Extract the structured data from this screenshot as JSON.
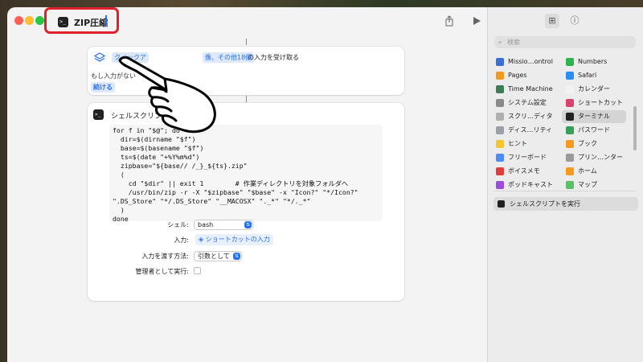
{
  "window": {
    "title": "ZIP圧縮"
  },
  "action_card_input": {
    "pill_quick": "クイックア",
    "pill_image": "像、その他18個",
    "receive_text": "の入力を受け取る",
    "no_input_text": "もし入力がない",
    "continue_label": "続ける"
  },
  "action_card_script": {
    "title": "シェルスクリプトを実行",
    "code": "for f in \"$@\"; do\n  dir=$(dirname \"$f\")\n  base=$(basename \"$f\")\n  ts=$(date \"+%Y%m%d\")\n  zipbase=\"${base// /_}_${ts}.zip\"\n  (\n    cd \"$dir\" || exit 1        # 作業ディレクトリを対象フォルダへ\n    /usr/bin/zip -r -X \"$zipbase\" \"$base\" -x \"Icon?\" \"*/Icon?\"\n\".DS_Store\" \"*/.DS_Store\" \"__MACOSX\" \"._*\" \"*/._*\"\n  )\ndone",
    "shell_label": "シェル:",
    "shell_value": "bash",
    "input_label": "入力:",
    "input_value": "ショートカットの入力",
    "pass_input_label": "入力を渡す方法:",
    "pass_input_value": "引数として",
    "run_as_admin_label": "管理者として実行:",
    "run_as_admin": false
  },
  "sidebar": {
    "search_placeholder": "検索",
    "left_items": [
      {
        "label": "Missio…ontrol",
        "icon": "mission-control-icon",
        "color": "#3a6fd8"
      },
      {
        "label": "Pages",
        "icon": "pages-icon",
        "color": "#f39a1e"
      },
      {
        "label": "Time Machine",
        "icon": "time-machine-icon",
        "color": "#3e7c59"
      },
      {
        "label": "システム設定",
        "icon": "settings-icon",
        "color": "#8a8a8a"
      },
      {
        "label": "スクリ…ディタ",
        "icon": "script-editor-icon",
        "color": "#b0b0b0"
      },
      {
        "label": "ディス…リティ",
        "icon": "disk-utility-icon",
        "color": "#9aa0a6"
      },
      {
        "label": "ヒント",
        "icon": "tips-icon",
        "color": "#f5c52b"
      },
      {
        "label": "フリーボード",
        "icon": "freeform-icon",
        "color": "#4c8df5"
      },
      {
        "label": "ボイスメモ",
        "icon": "voice-memos-icon",
        "color": "#e23c3c"
      },
      {
        "label": "ポッドキャスト",
        "icon": "podcasts-icon",
        "color": "#9b4de0"
      }
    ],
    "right_items": [
      {
        "label": "Numbers",
        "icon": "numbers-icon",
        "color": "#2fb34e"
      },
      {
        "label": "Safari",
        "icon": "safari-icon",
        "color": "#2a8ef5"
      },
      {
        "label": "カレンダー",
        "icon": "calendar-icon",
        "color": "#f2f2f2"
      },
      {
        "label": "ショートカット",
        "icon": "shortcuts-icon",
        "color": "#d9436f"
      },
      {
        "label": "ターミナル",
        "icon": "terminal-icon",
        "color": "#222222"
      },
      {
        "label": "パスワード",
        "icon": "passwords-icon",
        "color": "#3a9d5c"
      },
      {
        "label": "ブック",
        "icon": "books-icon",
        "color": "#f59a1e"
      },
      {
        "label": "プリン…ンター",
        "icon": "printer-icon",
        "color": "#9a9a9a"
      },
      {
        "label": "ホーム",
        "icon": "home-icon",
        "color": "#f59a1e"
      },
      {
        "label": "マップ",
        "icon": "maps-icon",
        "color": "#5cbf6a"
      }
    ],
    "bottom_action": "シェルスクリプトを実行"
  },
  "colors": {
    "accent": "#2a6ff0",
    "highlight_box": "#e0202a"
  }
}
